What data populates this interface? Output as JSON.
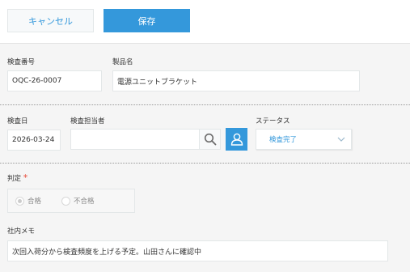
{
  "toolbar": {
    "cancel_label": "キャンセル",
    "save_label": "保存"
  },
  "record": {
    "inspection_no": {
      "label": "検査番号",
      "value": "OQC-26-0007"
    },
    "product_name": {
      "label": "製品名",
      "value": "電源ユニットブラケット"
    },
    "inspection_date": {
      "label": "検査日",
      "value": "2026-03-24"
    },
    "inspector": {
      "label": "検査担当者",
      "value": ""
    },
    "status": {
      "label": "ステータス",
      "value": "検査完了"
    },
    "judgement": {
      "label": "判定",
      "required_mark": "*",
      "options": [
        "合格",
        "不合格"
      ],
      "selected": "合格"
    },
    "memo": {
      "label": "社内メモ",
      "value": "次回入荷分から検査頻度を上げる予定。山田さんに確認中"
    }
  },
  "colors": {
    "accent": "#3498db",
    "required": "#e74c3c"
  },
  "icons": {
    "search": "search-icon",
    "user": "user-icon",
    "dropdown": "chevron-down-icon"
  }
}
